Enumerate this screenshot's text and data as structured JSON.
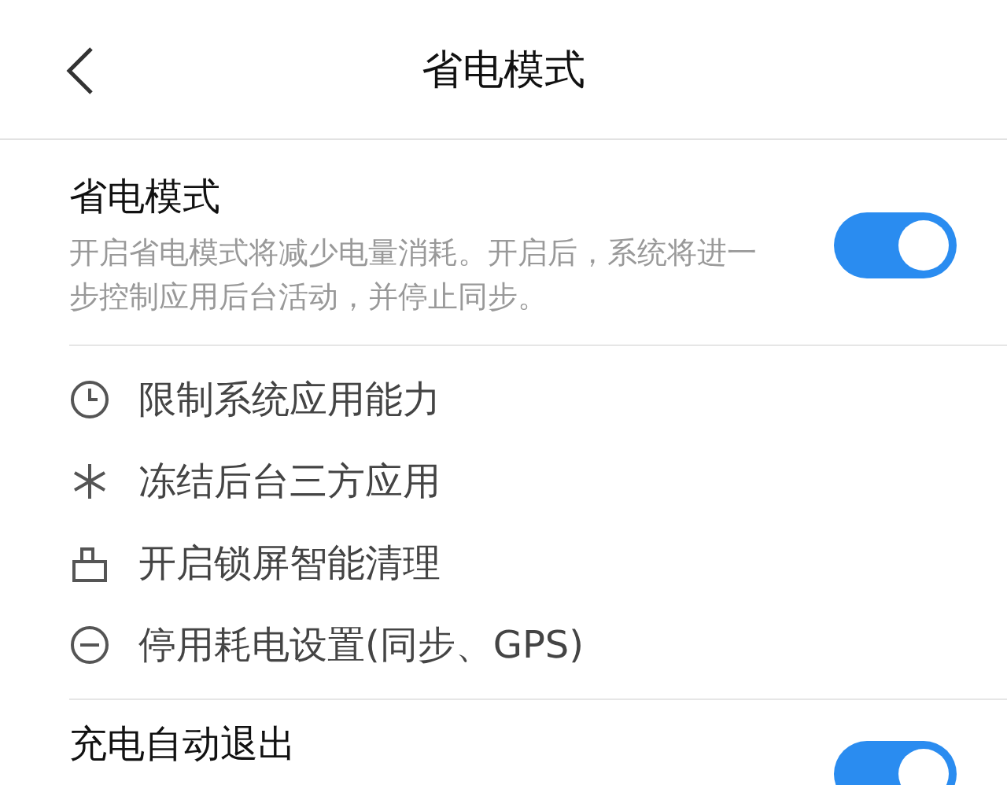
{
  "header": {
    "title": "省电模式"
  },
  "main_setting": {
    "title": "省电模式",
    "description": "开启省电模式将减少电量消耗。开启后，系统将进一步控制应用后台活动，并停止同步。",
    "on": true
  },
  "effects": [
    {
      "kind": "clock",
      "label": "限制系统应用能力"
    },
    {
      "kind": "snowflake",
      "label": "冻结后台三方应用"
    },
    {
      "kind": "lock",
      "label": "开启锁屏智能清理"
    },
    {
      "kind": "minus",
      "label": "停用耗电设置(同步、GPS)"
    }
  ],
  "next_setting": {
    "title": "充电自动退出",
    "on": true
  }
}
